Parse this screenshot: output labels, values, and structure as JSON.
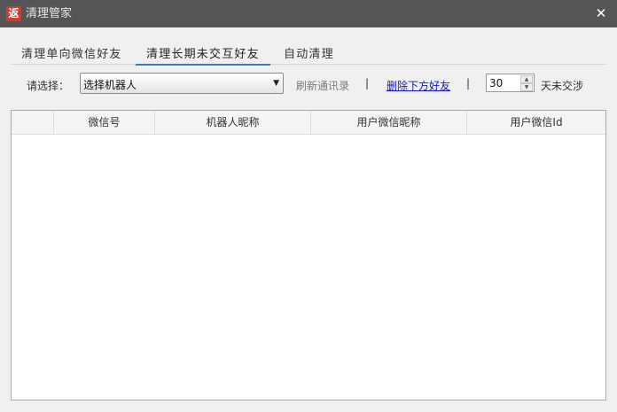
{
  "window": {
    "app_icon_glyph": "返",
    "title": "清理管家",
    "close_glyph": "✕"
  },
  "tabs": [
    {
      "label": "清理单向微信好友",
      "active": false
    },
    {
      "label": "清理长期未交互好友",
      "active": true
    },
    {
      "label": "自动清理",
      "active": false
    }
  ],
  "toolbar": {
    "select_label": "请选择：",
    "robot_select_value": "选择机器人",
    "refresh_label": "刷新通讯录",
    "separator": "|",
    "delete_label": "删除下方好友",
    "days_value": "30",
    "days_suffix": "天未交涉"
  },
  "table": {
    "columns": [
      "",
      "微信号",
      "机器人昵称",
      "用户微信昵称",
      "用户微信Id"
    ],
    "rows": []
  },
  "colors": {
    "titlebar": "#555555",
    "accent": "#3d78c2",
    "link": "#1616c8",
    "icon": "#d8362a"
  }
}
